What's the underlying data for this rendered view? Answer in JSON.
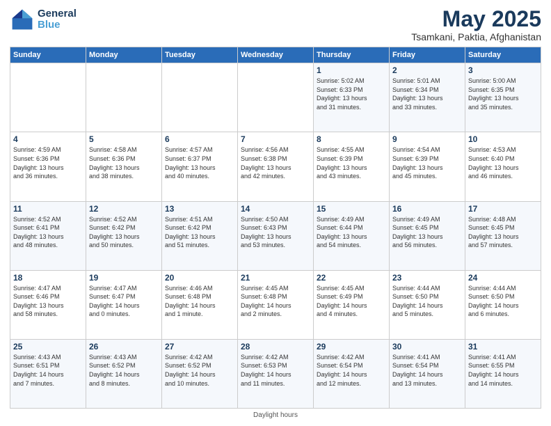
{
  "header": {
    "logo_line1": "General",
    "logo_line2": "Blue",
    "month": "May 2025",
    "location": "Tsamkani, Paktia, Afghanistan"
  },
  "days_of_week": [
    "Sunday",
    "Monday",
    "Tuesday",
    "Wednesday",
    "Thursday",
    "Friday",
    "Saturday"
  ],
  "footer": "Daylight hours",
  "weeks": [
    [
      {
        "day": "",
        "info": ""
      },
      {
        "day": "",
        "info": ""
      },
      {
        "day": "",
        "info": ""
      },
      {
        "day": "",
        "info": ""
      },
      {
        "day": "1",
        "info": "Sunrise: 5:02 AM\nSunset: 6:33 PM\nDaylight: 13 hours\nand 31 minutes."
      },
      {
        "day": "2",
        "info": "Sunrise: 5:01 AM\nSunset: 6:34 PM\nDaylight: 13 hours\nand 33 minutes."
      },
      {
        "day": "3",
        "info": "Sunrise: 5:00 AM\nSunset: 6:35 PM\nDaylight: 13 hours\nand 35 minutes."
      }
    ],
    [
      {
        "day": "4",
        "info": "Sunrise: 4:59 AM\nSunset: 6:36 PM\nDaylight: 13 hours\nand 36 minutes."
      },
      {
        "day": "5",
        "info": "Sunrise: 4:58 AM\nSunset: 6:36 PM\nDaylight: 13 hours\nand 38 minutes."
      },
      {
        "day": "6",
        "info": "Sunrise: 4:57 AM\nSunset: 6:37 PM\nDaylight: 13 hours\nand 40 minutes."
      },
      {
        "day": "7",
        "info": "Sunrise: 4:56 AM\nSunset: 6:38 PM\nDaylight: 13 hours\nand 42 minutes."
      },
      {
        "day": "8",
        "info": "Sunrise: 4:55 AM\nSunset: 6:39 PM\nDaylight: 13 hours\nand 43 minutes."
      },
      {
        "day": "9",
        "info": "Sunrise: 4:54 AM\nSunset: 6:39 PM\nDaylight: 13 hours\nand 45 minutes."
      },
      {
        "day": "10",
        "info": "Sunrise: 4:53 AM\nSunset: 6:40 PM\nDaylight: 13 hours\nand 46 minutes."
      }
    ],
    [
      {
        "day": "11",
        "info": "Sunrise: 4:52 AM\nSunset: 6:41 PM\nDaylight: 13 hours\nand 48 minutes."
      },
      {
        "day": "12",
        "info": "Sunrise: 4:52 AM\nSunset: 6:42 PM\nDaylight: 13 hours\nand 50 minutes."
      },
      {
        "day": "13",
        "info": "Sunrise: 4:51 AM\nSunset: 6:42 PM\nDaylight: 13 hours\nand 51 minutes."
      },
      {
        "day": "14",
        "info": "Sunrise: 4:50 AM\nSunset: 6:43 PM\nDaylight: 13 hours\nand 53 minutes."
      },
      {
        "day": "15",
        "info": "Sunrise: 4:49 AM\nSunset: 6:44 PM\nDaylight: 13 hours\nand 54 minutes."
      },
      {
        "day": "16",
        "info": "Sunrise: 4:49 AM\nSunset: 6:45 PM\nDaylight: 13 hours\nand 56 minutes."
      },
      {
        "day": "17",
        "info": "Sunrise: 4:48 AM\nSunset: 6:45 PM\nDaylight: 13 hours\nand 57 minutes."
      }
    ],
    [
      {
        "day": "18",
        "info": "Sunrise: 4:47 AM\nSunset: 6:46 PM\nDaylight: 13 hours\nand 58 minutes."
      },
      {
        "day": "19",
        "info": "Sunrise: 4:47 AM\nSunset: 6:47 PM\nDaylight: 14 hours\nand 0 minutes."
      },
      {
        "day": "20",
        "info": "Sunrise: 4:46 AM\nSunset: 6:48 PM\nDaylight: 14 hours\nand 1 minute."
      },
      {
        "day": "21",
        "info": "Sunrise: 4:45 AM\nSunset: 6:48 PM\nDaylight: 14 hours\nand 2 minutes."
      },
      {
        "day": "22",
        "info": "Sunrise: 4:45 AM\nSunset: 6:49 PM\nDaylight: 14 hours\nand 4 minutes."
      },
      {
        "day": "23",
        "info": "Sunrise: 4:44 AM\nSunset: 6:50 PM\nDaylight: 14 hours\nand 5 minutes."
      },
      {
        "day": "24",
        "info": "Sunrise: 4:44 AM\nSunset: 6:50 PM\nDaylight: 14 hours\nand 6 minutes."
      }
    ],
    [
      {
        "day": "25",
        "info": "Sunrise: 4:43 AM\nSunset: 6:51 PM\nDaylight: 14 hours\nand 7 minutes."
      },
      {
        "day": "26",
        "info": "Sunrise: 4:43 AM\nSunset: 6:52 PM\nDaylight: 14 hours\nand 8 minutes."
      },
      {
        "day": "27",
        "info": "Sunrise: 4:42 AM\nSunset: 6:52 PM\nDaylight: 14 hours\nand 10 minutes."
      },
      {
        "day": "28",
        "info": "Sunrise: 4:42 AM\nSunset: 6:53 PM\nDaylight: 14 hours\nand 11 minutes."
      },
      {
        "day": "29",
        "info": "Sunrise: 4:42 AM\nSunset: 6:54 PM\nDaylight: 14 hours\nand 12 minutes."
      },
      {
        "day": "30",
        "info": "Sunrise: 4:41 AM\nSunset: 6:54 PM\nDaylight: 14 hours\nand 13 minutes."
      },
      {
        "day": "31",
        "info": "Sunrise: 4:41 AM\nSunset: 6:55 PM\nDaylight: 14 hours\nand 14 minutes."
      }
    ]
  ]
}
